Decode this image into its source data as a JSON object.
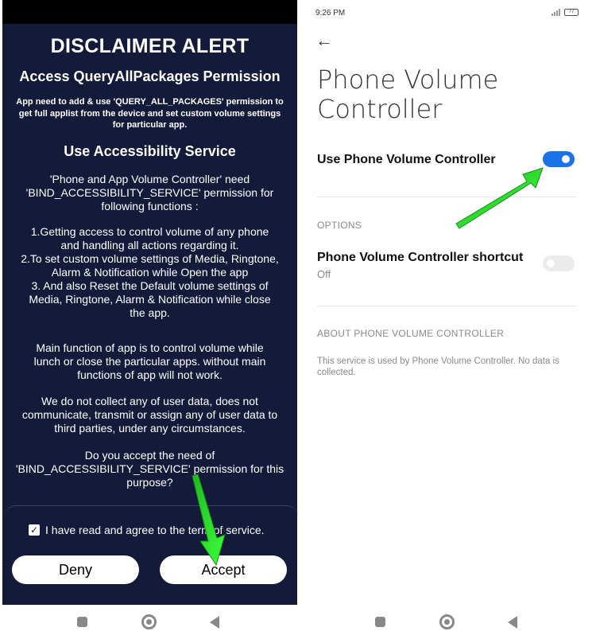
{
  "left_screen": {
    "title": "DISCLAIMER ALERT",
    "heading_packages": "Access QueryAllPackages Permission",
    "packages_text": "App need to add & use  'QUERY_ALL_PACKAGES' permission to get full applist from the device and set custom volume settings for particular app.",
    "heading_accessibility": "Use Accessibility Service",
    "para_need": "'Phone and App Volume Controller' need\n'BIND_ACCESSIBILITY_SERVICE' permission for\nfollowing functions :",
    "para_functions": "1.Getting access to control volume of any phone\nand handling all actions regarding it.\n2.To set custom volume settings of Media, Ringtone,\nAlarm & Notification while Open the app\n3. And also Reset the Default volume settings of\nMedia, Ringtone, Alarm & Notification while close\nthe app.",
    "para_main": "Main function of app is to control volume while\nlunch or close the particular apps. without main\nfunctions of app will not work.",
    "para_data": "We do not collect any of user data, does not\ncommunicate, transmit or assign any of user data to\nthird parties, under any circumstances.",
    "para_question": "Do you accept the need of\n'BIND_ACCESSIBILITY_SERVICE' permission for this\npurpose?",
    "agree_label": "I have read and agree to the term  of service.",
    "checkbox_mark": "✓",
    "deny_label": "Deny",
    "accept_label": "Accept",
    "colors": {
      "background": "#141b3a",
      "arrow": "#2ee62e"
    }
  },
  "right_screen": {
    "status_time": "9:26 PM",
    "battery": "77",
    "back_glyph": "←",
    "page_title": "Phone Volume Controller",
    "use_label": "Use Phone Volume Controller",
    "use_toggle": "on",
    "section_options": "OPTIONS",
    "shortcut_label": "Phone Volume Controller shortcut",
    "shortcut_value": "Off",
    "shortcut_toggle": "off",
    "section_about": "ABOUT PHONE VOLUME CONTROLLER",
    "about_text": "This service is used by Phone Volume Controller. No data is collected.",
    "colors": {
      "toggle_on": "#1a73e8"
    }
  },
  "nav_icons": [
    "recents-square-icon",
    "home-circle-icon",
    "back-triangle-icon"
  ]
}
